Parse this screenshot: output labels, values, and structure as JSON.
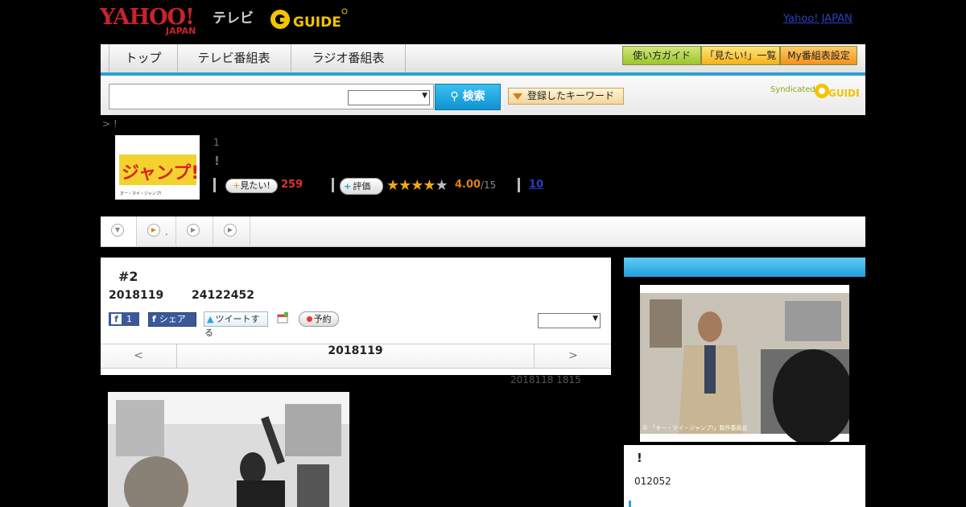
{
  "header": {
    "yahoo_logo_main": "YAHOO!",
    "yahoo_logo_sub": "JAPAN",
    "tv_label": "テレビ",
    "gguide_logo": "G-GUIDE",
    "yahoo_japan_link": "Yahoo! JAPAN"
  },
  "nav": {
    "tabs": [
      {
        "label": "トップ"
      },
      {
        "label": "テレビ番組表"
      },
      {
        "label": "ラジオ番組表"
      }
    ],
    "buttons": {
      "guide": "使い方ガイド",
      "mitai_list": "「見たい!」一覧",
      "my_schedule": "My番組表設定"
    }
  },
  "search": {
    "input_value": "",
    "select_value": "",
    "button_label": "検索",
    "keyword_button": "登録したキーワード",
    "syndicated": "Syndicated"
  },
  "program": {
    "breadcrumb": "> !",
    "thumb_caption": "オー・マイ・ジャンプ!",
    "episode_count": "1",
    "title_mark": "!",
    "mitai_button": "見たい!",
    "mitai_count": "259",
    "rating_button": "評価",
    "stars": 4,
    "rating_value": "4.00",
    "rating_count": "/15",
    "review_link": "10"
  },
  "subnav": {
    "items": [
      {
        "label": ""
      },
      {
        "label": "."
      },
      {
        "label": ""
      },
      {
        "label": ""
      }
    ]
  },
  "episode": {
    "title": "#2",
    "date": "2018119",
    "time": "24122452",
    "like_count": "1",
    "share_label": "シェア",
    "tweet_label": "ツイートする",
    "reserve_label": "予約",
    "select_value": "",
    "pager_prev": "<",
    "pager_current": "2018119",
    "pager_next": ">",
    "updated": "2018118  1815"
  },
  "side": {
    "photo_caption": "© 「オー・マイ・ジャンプ!」製作委員会",
    "title": "!",
    "date": "012052"
  },
  "colors": {
    "accent_blue": "#2aa0d8",
    "rating_orange": "#e0801a",
    "mitai_red": "#e0332e",
    "link_blue": "#2a3fbf"
  }
}
